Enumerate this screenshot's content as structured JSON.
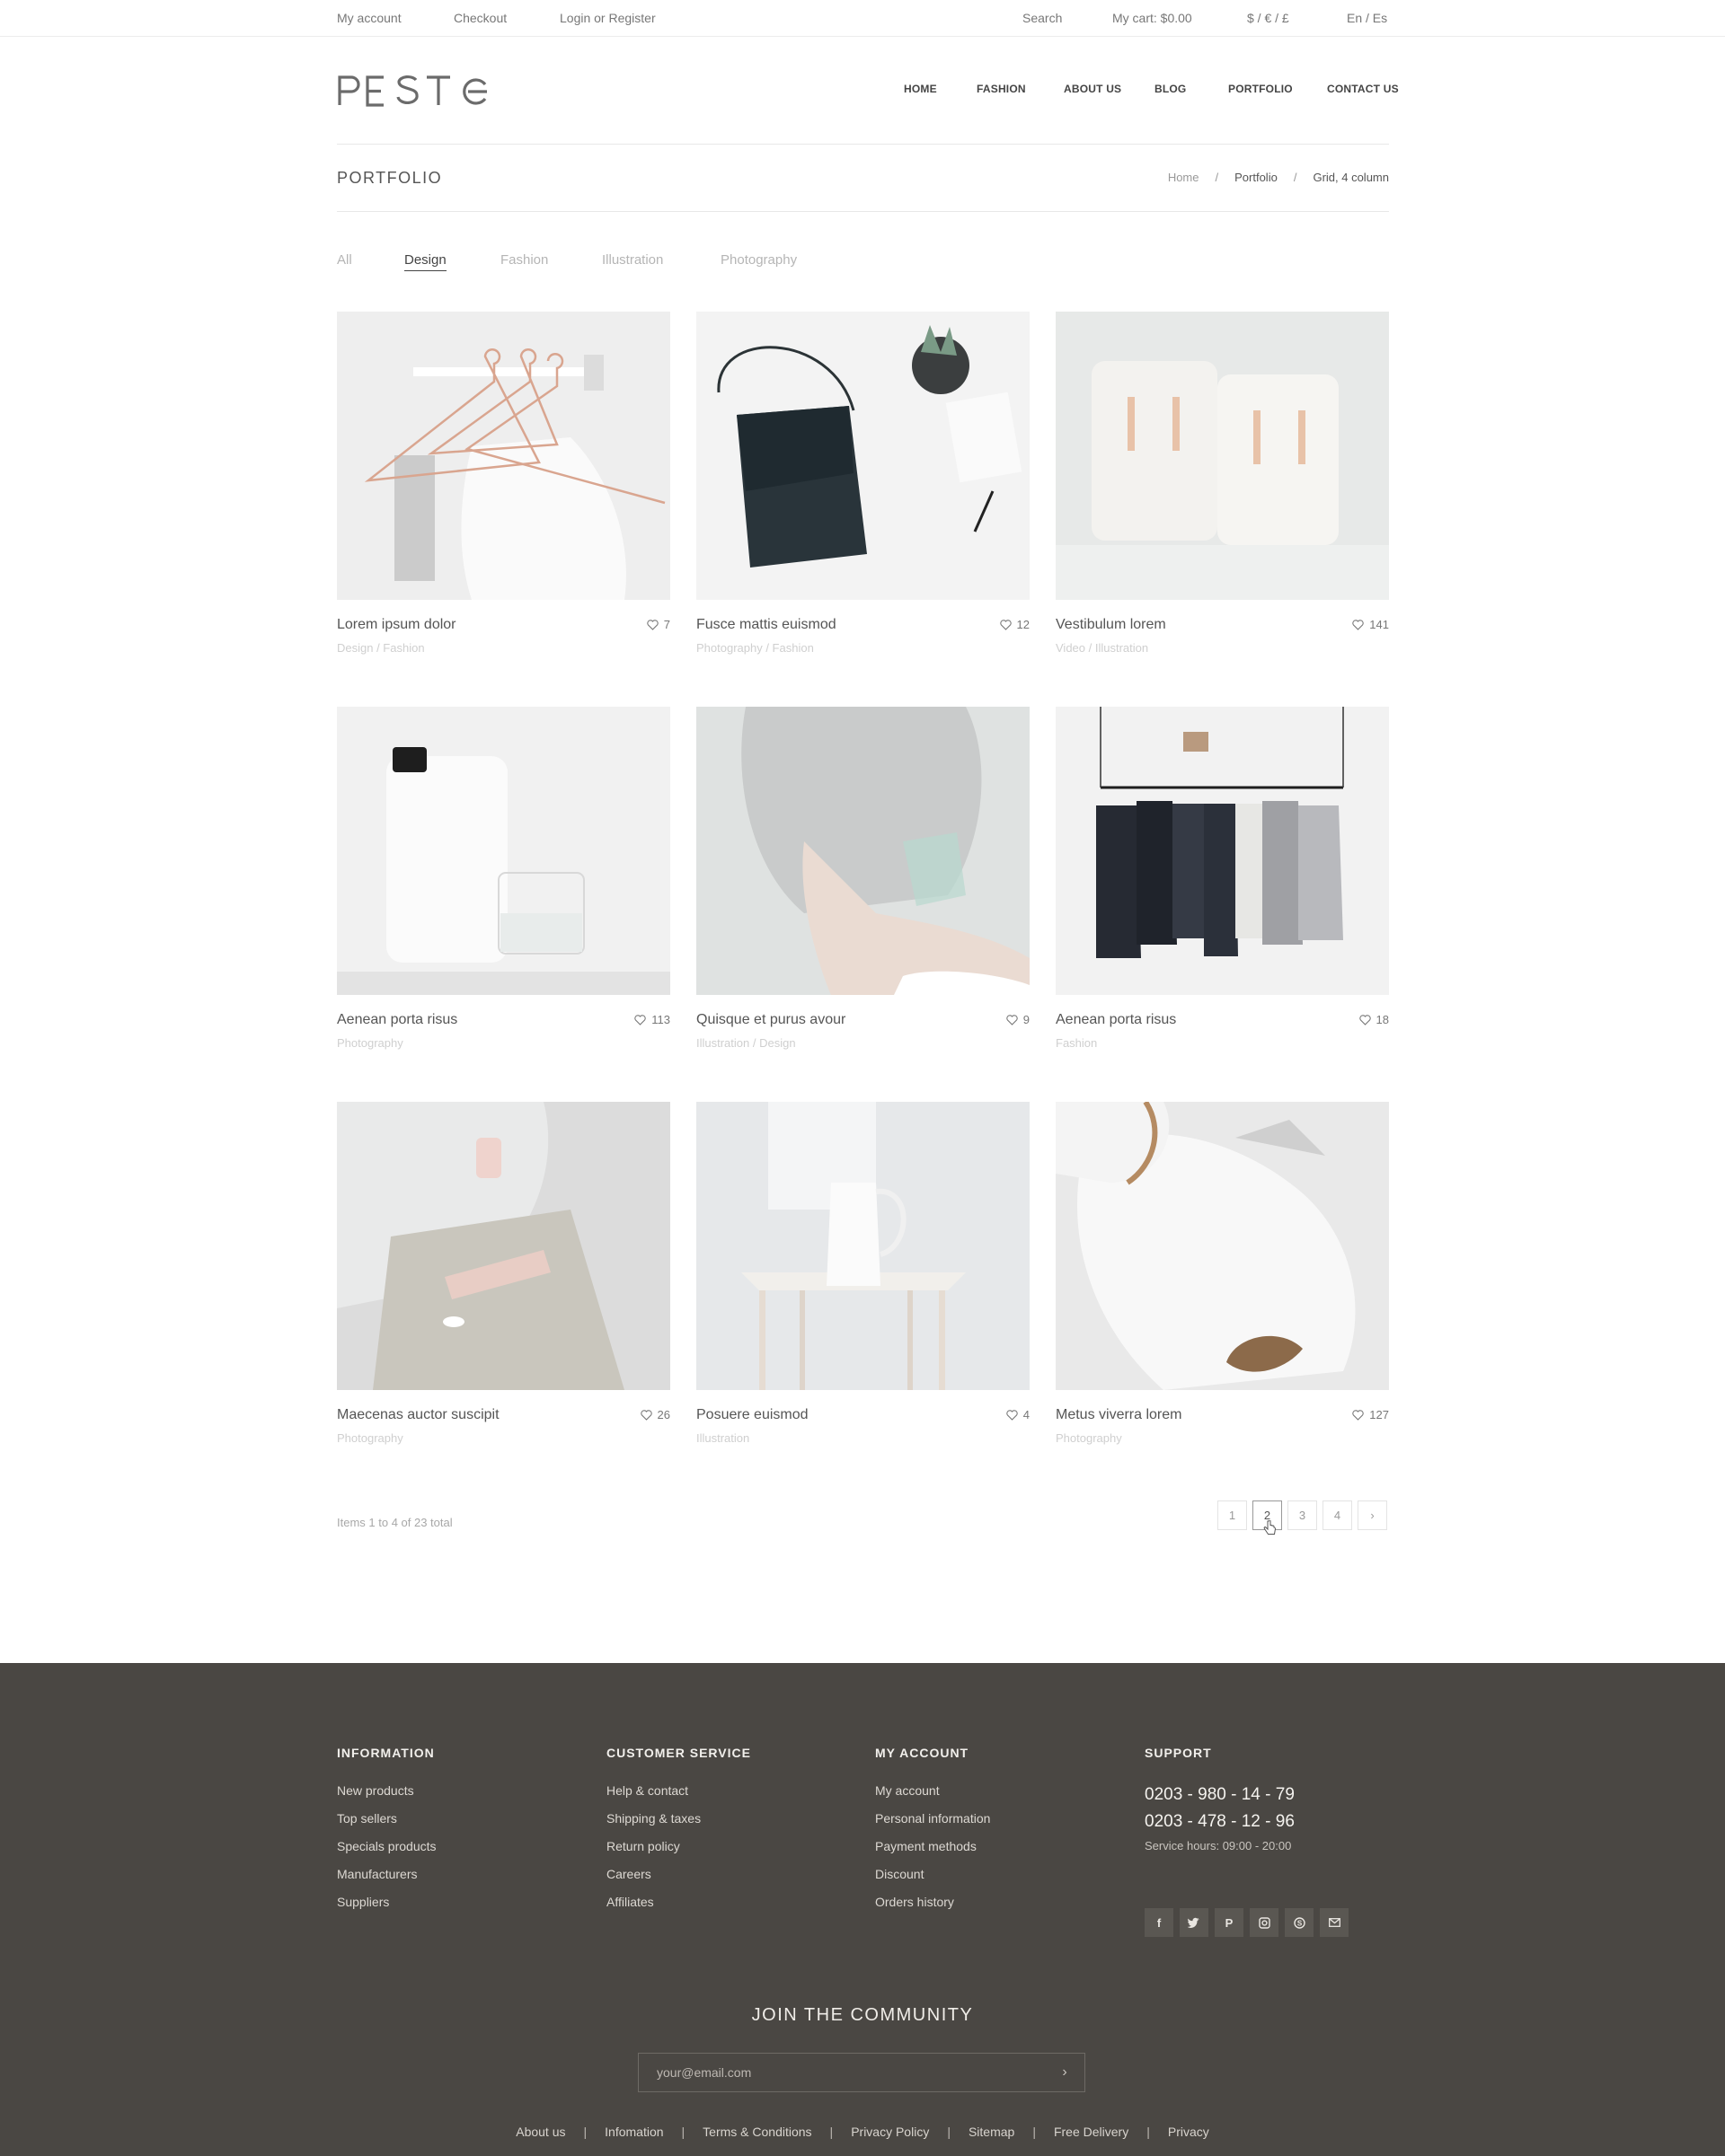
{
  "topbar": {
    "my_account": "My account",
    "checkout": "Checkout",
    "login": "Login or Register",
    "search": "Search",
    "cart": "My cart: $0.00",
    "currency": "$ / € / £",
    "language": "En / Es"
  },
  "logo": {
    "text": "PESTO"
  },
  "nav": {
    "home": "HOME",
    "fashion": "FASHION",
    "about": "ABOUT US",
    "blog": "BLOG",
    "portfolio": "PORTFOLIO",
    "contact": "CONTACT US"
  },
  "page": {
    "title": "PORTFOLIO"
  },
  "breadcrumb": {
    "home": "Home",
    "sep": "/",
    "portfolio": "Portfolio",
    "current": "Grid, 4 column"
  },
  "filters": {
    "all": "All",
    "design": "Design",
    "fashion": "Fashion",
    "illustration": "Illustration",
    "photography": "Photography",
    "active": "Design"
  },
  "items": [
    {
      "title": "Lorem ipsum dolor",
      "category": "Design / Fashion",
      "likes": "7"
    },
    {
      "title": "Fusce mattis euismod",
      "category": "Photography / Fashion",
      "likes": "12"
    },
    {
      "title": "Vestibulum lorem",
      "category": "Video / Illustration",
      "likes": "141"
    },
    {
      "title": "Aenean porta risus",
      "category": "Photography",
      "likes": "113"
    },
    {
      "title": "Quisque et purus avour",
      "category": "Illustration / Design",
      "likes": "9"
    },
    {
      "title": "Aenean porta risus",
      "category": "Fashion",
      "likes": "18"
    },
    {
      "title": "Maecenas auctor suscipit",
      "category": "Photography",
      "likes": "26"
    },
    {
      "title": "Posuere euismod",
      "category": "Illustration",
      "likes": "4"
    },
    {
      "title": "Metus viverra lorem",
      "category": "Photography",
      "likes": "127"
    }
  ],
  "pagination": {
    "info": "Items 1 to 4 of 23 total",
    "pages": [
      "1",
      "2",
      "3",
      "4"
    ],
    "current": "2",
    "next": "›"
  },
  "footer": {
    "information": {
      "heading": "INFORMATION",
      "links": [
        "New products",
        "Top sellers",
        "Specials products",
        "Manufacturers",
        "Suppliers"
      ]
    },
    "customer_service": {
      "heading": "CUSTOMER SERVICE",
      "links": [
        "Help & contact",
        "Shipping & taxes",
        "Return policy",
        "Careers",
        "Affiliates"
      ]
    },
    "my_account": {
      "heading": "MY ACCOUNT",
      "links": [
        "My account",
        "Personal information",
        "Payment methods",
        "Discount",
        "Orders history"
      ]
    },
    "support": {
      "heading": "SUPPORT",
      "phone1": "0203 - 980 - 14 - 79",
      "phone2": "0203 - 478 - 12 - 96",
      "hours": "Service hours: 09:00 - 20:00"
    },
    "social_icons": [
      "facebook-icon",
      "twitter-icon",
      "pinterest-icon",
      "instagram-icon",
      "skype-icon",
      "mail-icon"
    ],
    "join": "JOIN THE COMMUNITY",
    "email_placeholder": "your@email.com",
    "bottom_links": [
      "About us",
      "Infomation",
      "Terms & Conditions",
      "Privacy Policy",
      "Sitemap",
      "Free Delivery",
      "Privacy"
    ],
    "bottom_sep": "|"
  },
  "colors": {
    "footer_bg": "#4a4743",
    "text": "#555555",
    "muted": "#cfcfcf",
    "accent_pink": "#e9c9bf"
  }
}
